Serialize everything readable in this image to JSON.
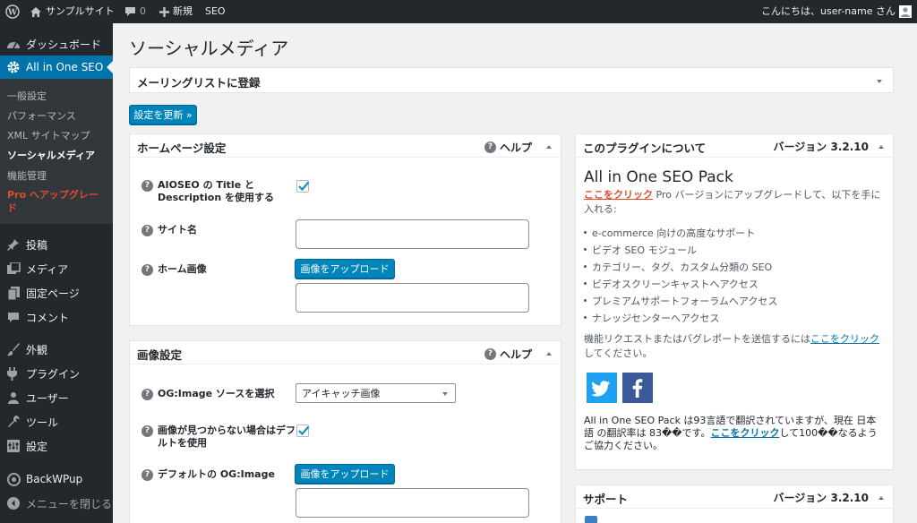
{
  "admin_bar": {
    "site_name": "サンプルサイト",
    "comments_count": "0",
    "new_label": "新規",
    "seo_label": "SEO",
    "greeting": "こんにちは、user-name さん"
  },
  "sidebar": {
    "dashboard": "ダッシュボード",
    "aioseo": "All in One SEO",
    "sub": {
      "general": "一般設定",
      "performance": "パフォーマンス",
      "sitemap": "XML サイトマップ",
      "social": "ソーシャルメディア",
      "features": "機能管理",
      "pro_prefix": "Pro",
      "pro_text": "へアップグレード"
    },
    "posts": "投稿",
    "media": "メディア",
    "pages": "固定ページ",
    "comments": "コメント",
    "appearance": "外観",
    "plugins": "プラグイン",
    "users": "ユーザー",
    "tools": "ツール",
    "settings": "設定",
    "backwpup": "BackWPup",
    "collapse": "メニューを閉じる"
  },
  "page_title": "ソーシャルメディア",
  "mailing_list": "メーリングリストに登録",
  "update_button": "設定を更新 »",
  "home_box": {
    "title": "ホームページ設定",
    "help": "ヘルプ",
    "use_title_label": "AIOSEO の Title と Description を使用する",
    "use_title_checked": true,
    "site_name_label": "サイト名",
    "site_name_value": "",
    "home_image_label": "ホーム画像",
    "upload_label": "画像をアップロード",
    "home_image_value": ""
  },
  "image_box": {
    "title": "画像設定",
    "help": "ヘルプ",
    "source_label": "OG:Image ソースを選択",
    "source_value": "アイキャッチ画像",
    "fallback_label": "画像が見つからない場合はデフォルトを使用",
    "fallback_checked": true,
    "default_label": "デフォルトの OG:Image",
    "upload_label": "画像をアップロード",
    "default_value": ""
  },
  "about_box": {
    "title": "このプラグインについて",
    "version": "バージョン 3.2.10",
    "product": "All in One SEO Pack",
    "upgrade_link": "ここをクリック",
    "upgrade_text": " Pro バージョンにアップグレードして、以下を手に入れる:",
    "features": [
      "e-commerce 向けの高度なサポート",
      "ビデオ SEO モジュール",
      "カテゴリー、タグ、カスタム分類の SEO",
      "ビデオスクリーンキャストへアクセス",
      "プレミアムサポートフォーラムへアクセス",
      "ナレッジセンターへアクセス"
    ],
    "request_text": "機能リクエストまたはバグレポートを送信するには",
    "request_link": "ここをクリック",
    "request_suffix": "してください。",
    "translation_a": "All in One SEO Pack は93言語で翻訳されていますが、現在 日本語 の翻訳率は 83��です。",
    "translation_link": "ここをクリック",
    "translation_b": "して100��なるようご協力ください。"
  },
  "support_box": {
    "title": "サポート",
    "version": "バージョン 3.2.10"
  },
  "colors": {
    "admin_bar": "#23282d",
    "menu_active": "#0073aa",
    "button": "#0085ba",
    "pro": "#dd4b2b",
    "twitter": "#1da1f2",
    "facebook": "#3b5998"
  }
}
